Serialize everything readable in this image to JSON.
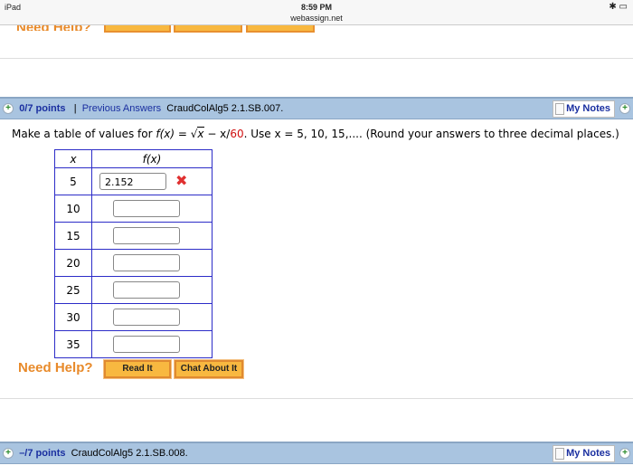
{
  "status": {
    "device": "iPad",
    "time": "8:59 PM",
    "url": "webassign.net"
  },
  "prev": {
    "need_help": "Need Help?"
  },
  "q1": {
    "points": "0/7 points",
    "separator": "|",
    "previous": "Previous Answers",
    "code": "CraudColAlg5 2.1.SB.007.",
    "notes": "My Notes",
    "text_pre": "Make a table of values for ",
    "fx": "f(x)",
    "eq": " = √",
    "x": "x",
    "minus": " − x/",
    "sixty": "60",
    "text_post": ".  Use  x = 5, 10, 15,....  (Round your answers to three decimal places.)",
    "col_x": "x",
    "col_f": "f(x)",
    "rows": [
      {
        "x": "5",
        "value": "2.152",
        "status": "incorrect"
      },
      {
        "x": "10",
        "value": ""
      },
      {
        "x": "15",
        "value": ""
      },
      {
        "x": "20",
        "value": ""
      },
      {
        "x": "25",
        "value": ""
      },
      {
        "x": "30",
        "value": ""
      },
      {
        "x": "35",
        "value": ""
      }
    ],
    "need_help": "Need Help?",
    "read_it": "Read It",
    "chat": "Chat About It",
    "wrong_mark": "✖"
  },
  "q2": {
    "points": "–/7 points",
    "code": "CraudColAlg5 2.1.SB.008.",
    "notes": "My Notes"
  }
}
